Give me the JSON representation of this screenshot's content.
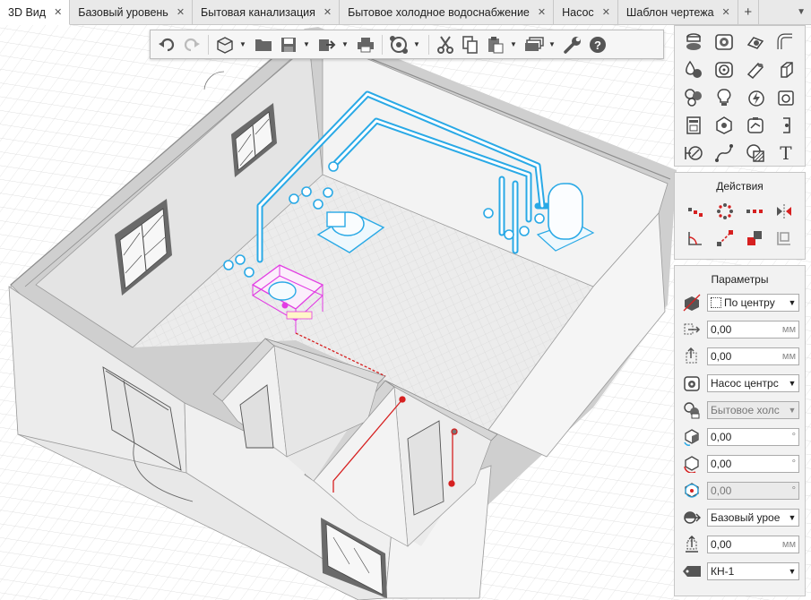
{
  "tabs": [
    {
      "label": "3D Вид",
      "active": true
    },
    {
      "label": "Базовый уровень"
    },
    {
      "label": "Бытовая канализация"
    },
    {
      "label": "Бытовое холодное водоснабжение"
    },
    {
      "label": "Насос"
    },
    {
      "label": "Шаблон чертежа"
    }
  ],
  "tab_add_label": "+",
  "tab_menu_icon": "chevron-down-icon",
  "tab_close_glyph": "✕",
  "toolbar": {
    "icons": [
      "undo-icon",
      "redo-icon",
      "view-cube-icon",
      "open-folder-icon",
      "save-icon",
      "export-icon",
      "print-icon",
      "orbit-icon",
      "cut-icon",
      "copy-icon",
      "paste-icon",
      "layers-icon",
      "settings-wrench-icon",
      "help-icon"
    ]
  },
  "tools_palette": {
    "icons": [
      "pipe-fittings-icon",
      "valve-icon",
      "pump-small-icon",
      "pipe-bend-icon",
      "drop-icon",
      "sink-icon",
      "pipe-icon",
      "duct-icon",
      "shower-icon",
      "lamp-icon",
      "electric-icon",
      "boiler-icon",
      "panel-icon",
      "equipment-icon",
      "meter-icon",
      "connector-icon",
      "section-icon",
      "route-icon",
      "hatch-icon",
      "text-icon"
    ],
    "text_tool_label": "T"
  },
  "actions": {
    "title": "Действия",
    "icons": [
      "array-icon",
      "circular-array-icon",
      "linear-array-icon",
      "mirror-icon",
      "angle-icon",
      "align-icon",
      "move-icon",
      "copy-offset-icon"
    ]
  },
  "params": {
    "title": "Параметры",
    "rows": [
      {
        "icon": "insertion-point-icon",
        "value": "По центру",
        "type": "select",
        "prefix_icon": true
      },
      {
        "icon": "offset-x-icon",
        "value": "0,00",
        "unit": "мм",
        "type": "number"
      },
      {
        "icon": "offset-y-icon",
        "value": "0,00",
        "unit": "мм",
        "type": "number"
      },
      {
        "icon": "pump-type-icon",
        "value": "Насос центрс",
        "type": "select"
      },
      {
        "icon": "system-icon",
        "value": "Бытовое холс",
        "type": "select",
        "disabled": true
      },
      {
        "icon": "rotate-x-icon",
        "value": "0,00",
        "unit": "°",
        "type": "number"
      },
      {
        "icon": "rotate-y-icon",
        "value": "0,00",
        "unit": "°",
        "type": "number"
      },
      {
        "icon": "rotate-z-icon",
        "value": "0,00",
        "unit": "°",
        "type": "number",
        "disabled": true
      },
      {
        "icon": "level-icon",
        "value": "Базовый урое",
        "type": "select"
      },
      {
        "icon": "elevation-icon",
        "value": "0,00",
        "unit": "мм",
        "type": "number"
      },
      {
        "icon": "tag-icon",
        "value": "КН-1",
        "type": "select"
      }
    ]
  },
  "colors": {
    "selection_pipe": "#29a9e6",
    "selection_pump": "#e23ce3",
    "sewer_route": "#d62020",
    "wall": "#f2f2f2",
    "panel_bg": "#f2f2f2"
  }
}
